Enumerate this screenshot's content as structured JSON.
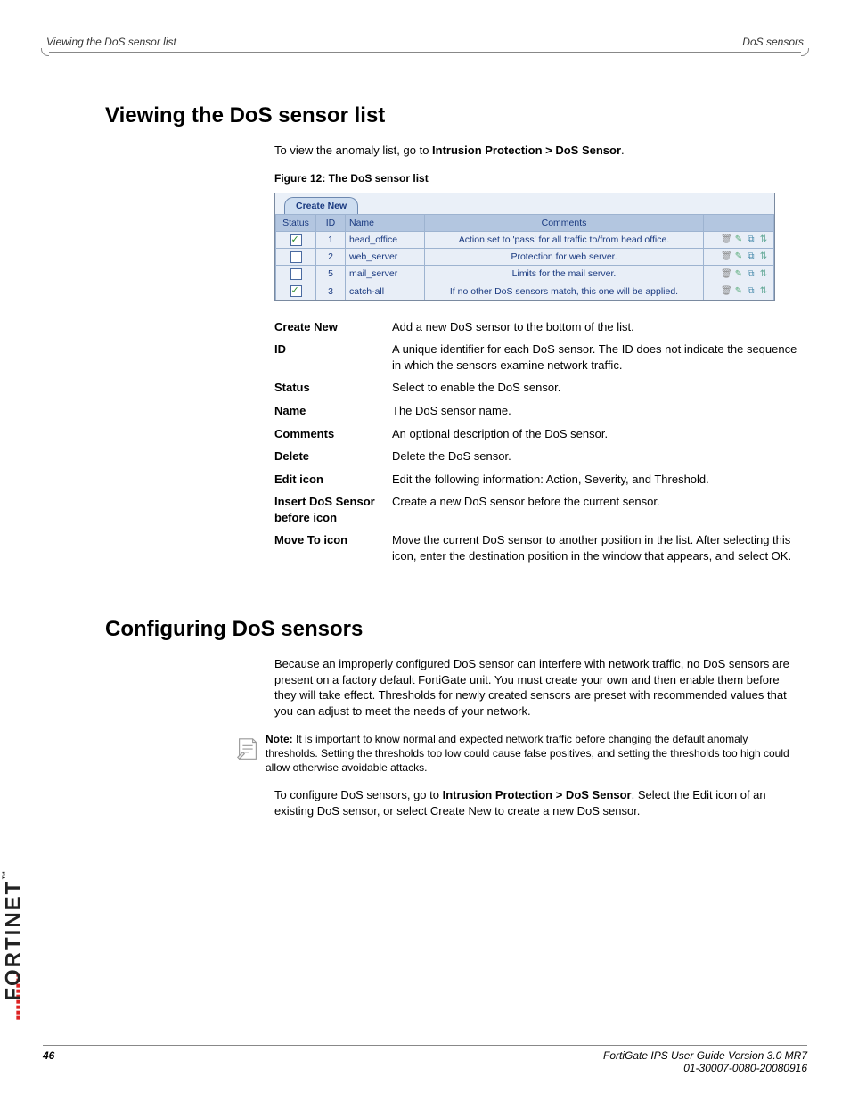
{
  "header": {
    "left": "Viewing the DoS sensor list",
    "right": "DoS sensors"
  },
  "section1": {
    "heading": "Viewing the DoS sensor list",
    "intro_pre": "To view the anomaly list, go to ",
    "intro_bold": "Intrusion Protection > DoS Sensor",
    "intro_post": ".",
    "fig_caption": "Figure 12: The DoS sensor list",
    "screenshot": {
      "create_new": "Create New",
      "cols": {
        "status": "Status",
        "id": "ID",
        "name": "Name",
        "comments": "Comments"
      },
      "rows": [
        {
          "checked": true,
          "id": "1",
          "name": "head_office",
          "comments": "Action set to 'pass' for all traffic to/from head office."
        },
        {
          "checked": false,
          "id": "2",
          "name": "web_server",
          "comments": "Protection for web server."
        },
        {
          "checked": false,
          "id": "5",
          "name": "mail_server",
          "comments": "Limits for the mail server."
        },
        {
          "checked": true,
          "id": "3",
          "name": "catch-all",
          "comments": "If no other DoS sensors match, this one will be applied."
        }
      ]
    },
    "defs": [
      {
        "term": "Create New",
        "desc": "Add a new DoS sensor to the bottom of the list."
      },
      {
        "term": "ID",
        "desc": "A unique identifier for each DoS sensor. The ID does not indicate the sequence in which the sensors examine network traffic."
      },
      {
        "term": "Status",
        "desc": "Select to enable the DoS sensor."
      },
      {
        "term": "Name",
        "desc": "The DoS sensor name."
      },
      {
        "term": "Comments",
        "desc": "An optional description of the DoS sensor."
      },
      {
        "term": "Delete",
        "desc": "Delete the DoS sensor."
      },
      {
        "term": "Edit icon",
        "desc": "Edit the following information: Action, Severity, and Threshold."
      },
      {
        "term": "Insert DoS Sensor before icon",
        "desc": "Create a new DoS sensor before the current sensor."
      },
      {
        "term": "Move To icon",
        "desc": "Move the current DoS sensor to another position in the list. After selecting this icon, enter the destination position in the window that appears, and select OK."
      }
    ]
  },
  "section2": {
    "heading": "Configuring DoS sensors",
    "para1": "Because an improperly configured DoS sensor can interfere with network traffic, no DoS sensors are present on a factory default FortiGate unit. You must create your own and then enable them before they will take effect. Thresholds for newly created sensors are preset with recommended values that you can adjust to meet the needs of your network.",
    "note_label": "Note:",
    "note_body": " It is important to know normal and expected network traffic before changing the default anomaly thresholds. Setting the thresholds too low could cause false positives, and setting the thresholds too high could allow otherwise avoidable attacks.",
    "para2_pre": "To configure DoS sensors, go to ",
    "para2_bold": "Intrusion Protection > DoS Sensor",
    "para2_post": ". Select the Edit icon of an existing DoS sensor, or select Create New to create a new DoS sensor."
  },
  "footer": {
    "page": "46",
    "line1": "FortiGate IPS User Guide Version 3.0 MR7",
    "line2": "01-30007-0080-20080916"
  },
  "brand": "FORTINET"
}
